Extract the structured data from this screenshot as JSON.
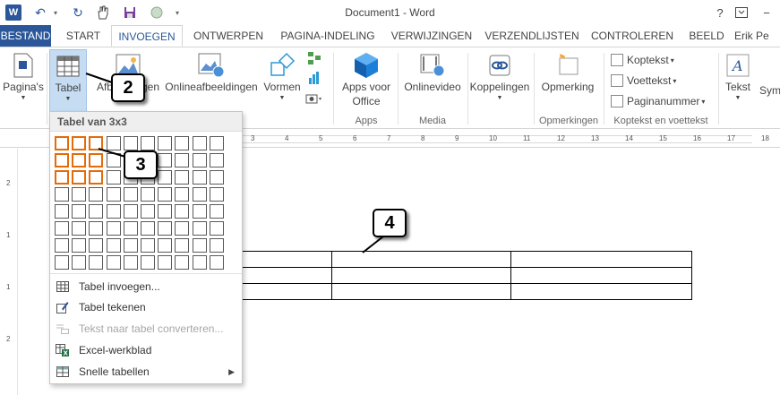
{
  "window": {
    "title": "Document1 - Word",
    "help": "?",
    "minimize": "−",
    "restore": "❐",
    "close": "✕"
  },
  "tabs": {
    "file": "BESTAND",
    "start": "START",
    "insert": "INVOEGEN",
    "design": "ONTWERPEN",
    "layout": "PAGINA-INDELING",
    "references": "VERWIJZINGEN",
    "mailings": "VERZENDLIJSTEN",
    "review": "CONTROLEREN",
    "view": "BEELD",
    "user": "Erik Pe"
  },
  "ribbon": {
    "pages": "Pagina's",
    "table": "Tabel",
    "pictures": "Afbeeldingen",
    "online_pictures": "Onlineafbeeldingen",
    "shapes": "Vormen",
    "apps_line1": "Apps voor",
    "apps_line2": "Office",
    "online_video": "Onlinevideo",
    "links": "Koppelingen",
    "comment": "Opmerking",
    "header": "Koptekst",
    "footer": "Voettekst",
    "page_number": "Paginanummer",
    "text": "Tekst",
    "symbols": "Sym",
    "group_apps": "Apps",
    "group_media": "Media",
    "group_comments": "Opmerkingen",
    "group_header_footer": "Koptekst en voettekst"
  },
  "ruler": {
    "h_numbers": [
      "3",
      "4",
      "5",
      "6",
      "7",
      "8",
      "9",
      "10",
      "11",
      "12",
      "13",
      "14",
      "15",
      "16",
      "17",
      "18"
    ],
    "v_numbers": [
      "2",
      "1",
      "1",
      "2"
    ]
  },
  "table_menu": {
    "heading": "Tabel van 3x3",
    "grid_columns": 10,
    "grid_rows": 8,
    "selected_columns": 3,
    "selected_rows": 3,
    "items": [
      {
        "label": "Tabel invoegen...",
        "disabled": false
      },
      {
        "label": "Tabel tekenen",
        "disabled": false
      },
      {
        "label": "Tekst naar tabel converteren...",
        "disabled": true
      },
      {
        "label": "Excel-werkblad",
        "disabled": false
      },
      {
        "label": "Snelle tabellen",
        "disabled": false
      }
    ]
  },
  "document_table": {
    "rows": 3,
    "columns": 3
  },
  "callouts": [
    "2",
    "3",
    "4"
  ],
  "colors": {
    "accent": "#2b579a",
    "highlight": "#e36c0a"
  }
}
